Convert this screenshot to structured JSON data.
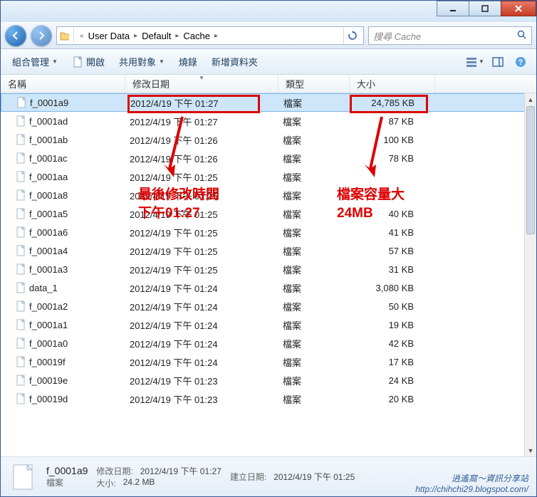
{
  "titlebar": {
    "min": "—",
    "max": "▢",
    "close": "✕"
  },
  "nav": {
    "back": "←",
    "fwd": "→",
    "crumbs": [
      "User Data",
      "Default",
      "Cache"
    ],
    "search_placeholder": "搜尋 Cache"
  },
  "toolbar": {
    "organize": "組合管理",
    "open": "開啟",
    "share": "共用對象",
    "burn": "燒錄",
    "newfolder": "新增資料夾"
  },
  "columns": {
    "name": "名稱",
    "date": "修改日期",
    "type": "類型",
    "size": "大小"
  },
  "files": [
    {
      "name": "f_0001a9",
      "date": "2012/4/19 下午 01:27",
      "type": "檔案",
      "size": "24,785 KB",
      "selected": true
    },
    {
      "name": "f_0001ad",
      "date": "2012/4/19 下午 01:27",
      "type": "檔案",
      "size": "87 KB"
    },
    {
      "name": "f_0001ab",
      "date": "2012/4/19 下午 01:26",
      "type": "檔案",
      "size": "100 KB"
    },
    {
      "name": "f_0001ac",
      "date": "2012/4/19 下午 01:26",
      "type": "檔案",
      "size": "78 KB"
    },
    {
      "name": "f_0001aa",
      "date": "2012/4/19 下午 01:25",
      "type": "檔案",
      "size": ""
    },
    {
      "name": "f_0001a8",
      "date": "2012/4/19 下午 01:25",
      "type": "檔案",
      "size": ""
    },
    {
      "name": "f_0001a5",
      "date": "2012/4/19 下午 01:25",
      "type": "檔案",
      "size": "40 KB"
    },
    {
      "name": "f_0001a6",
      "date": "2012/4/19 下午 01:25",
      "type": "檔案",
      "size": "41 KB"
    },
    {
      "name": "f_0001a4",
      "date": "2012/4/19 下午 01:25",
      "type": "檔案",
      "size": "57 KB"
    },
    {
      "name": "f_0001a3",
      "date": "2012/4/19 下午 01:25",
      "type": "檔案",
      "size": "31 KB"
    },
    {
      "name": "data_1",
      "date": "2012/4/19 下午 01:24",
      "type": "檔案",
      "size": "3,080 KB"
    },
    {
      "name": "f_0001a2",
      "date": "2012/4/19 下午 01:24",
      "type": "檔案",
      "size": "50 KB"
    },
    {
      "name": "f_0001a1",
      "date": "2012/4/19 下午 01:24",
      "type": "檔案",
      "size": "19 KB"
    },
    {
      "name": "f_0001a0",
      "date": "2012/4/19 下午 01:24",
      "type": "檔案",
      "size": "42 KB"
    },
    {
      "name": "f_00019f",
      "date": "2012/4/19 下午 01:24",
      "type": "檔案",
      "size": "17 KB"
    },
    {
      "name": "f_00019e",
      "date": "2012/4/19 下午 01:23",
      "type": "檔案",
      "size": "24 KB"
    },
    {
      "name": "f_00019d",
      "date": "2012/4/19 下午 01:23",
      "type": "檔案",
      "size": "20 KB"
    }
  ],
  "annotations": {
    "left_text_l1": "最後修改時間",
    "left_text_l2": "下午01:27",
    "right_text_l1": "檔案容量大",
    "right_text_l2": "24MB"
  },
  "details": {
    "name": "f_0001a9",
    "type": "檔案",
    "mod_label": "修改日期:",
    "mod": "2012/4/19 下午 01:27",
    "created_label": "建立日期:",
    "created": "2012/4/19 下午 01:25",
    "size_label": "大小:",
    "size": "24.2 MB"
  },
  "watermark": {
    "l1": "逍遙窩～資訊分享站",
    "l2": "http://chihchi29.blogspot.com/"
  }
}
